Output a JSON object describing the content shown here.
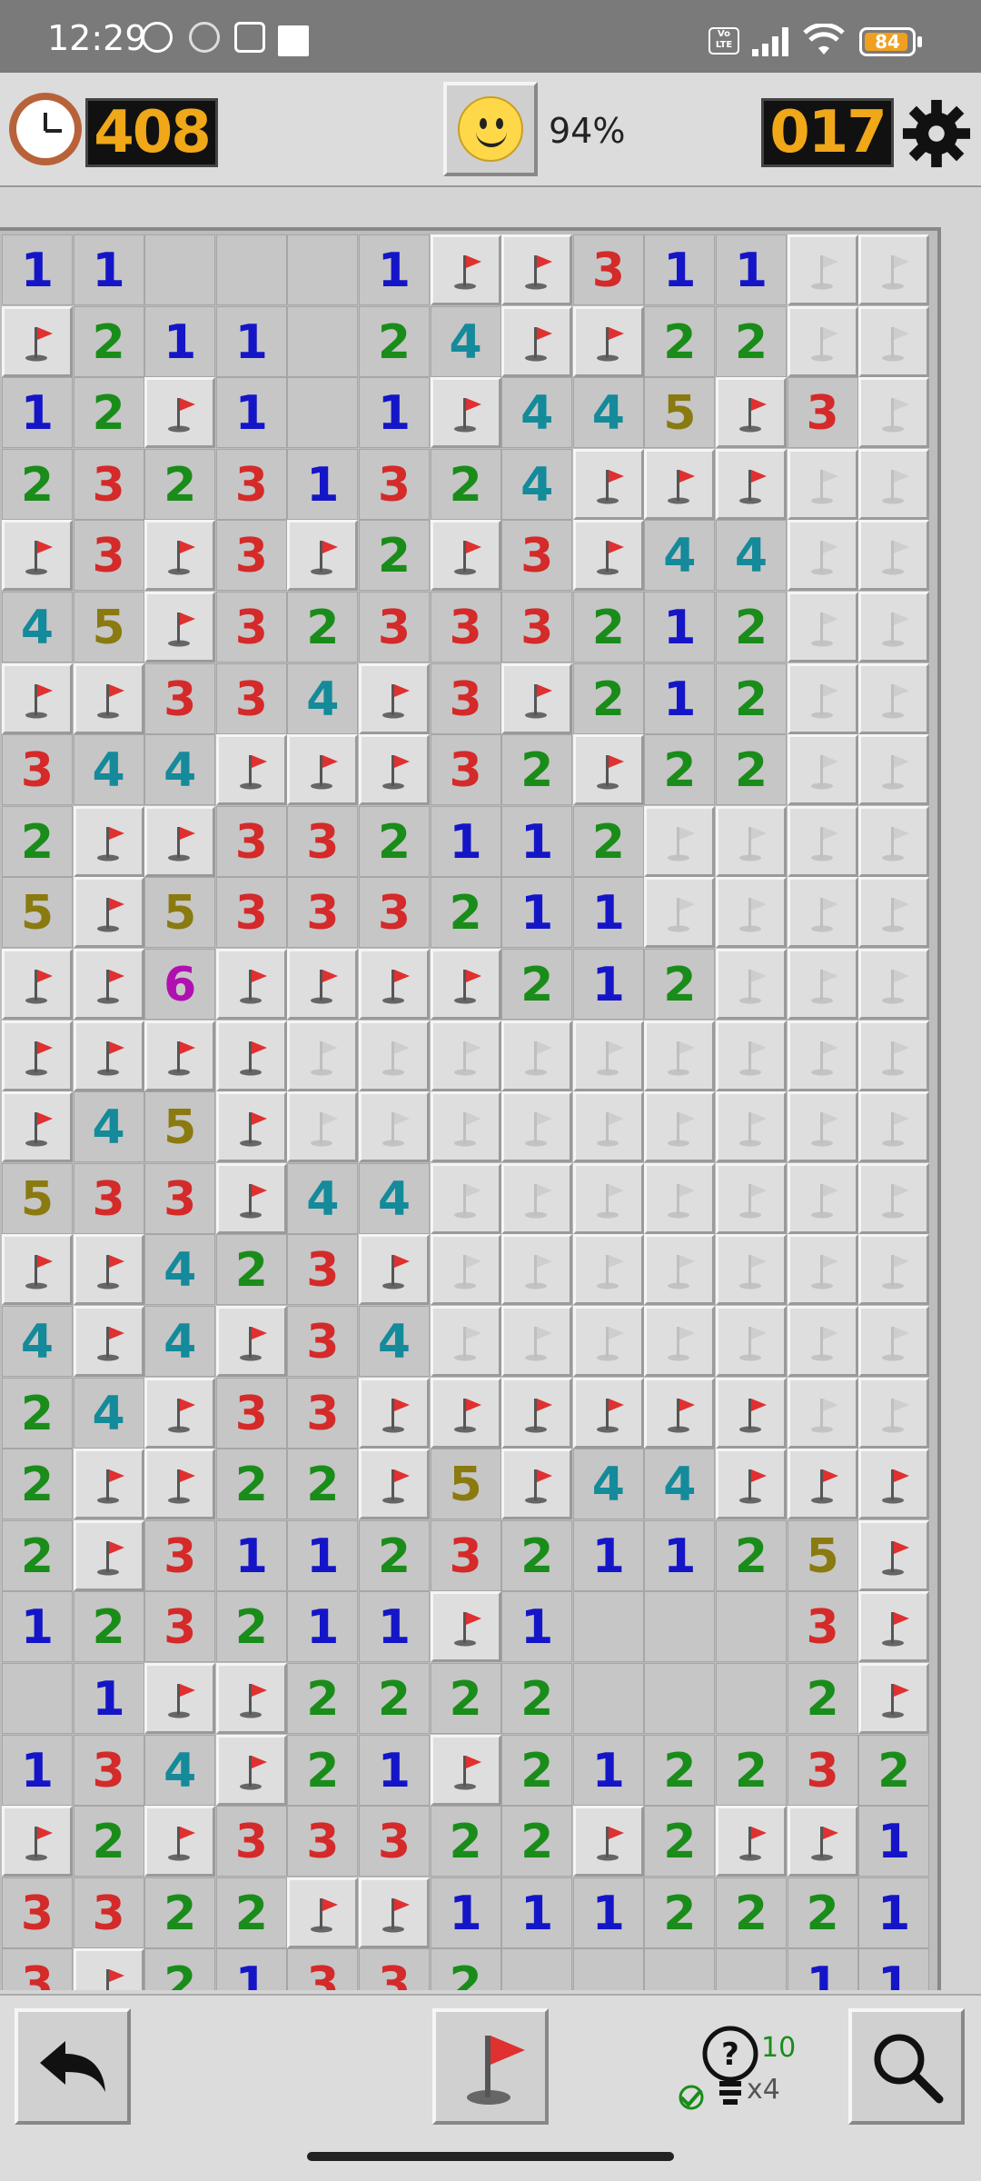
{
  "status_bar": {
    "time": "12:29",
    "battery": "84",
    "volte": "Vo LTE"
  },
  "game": {
    "timer": "408",
    "mines_remaining": "017",
    "progress": "94%",
    "hint_count": "10",
    "hint_multiplier": "x4"
  },
  "colors": {
    "n1": "#1515c8",
    "n2": "#1a8c1a",
    "n3": "#d42a2a",
    "n4": "#148a9a",
    "n5": "#8a7a10",
    "n6": "#b010b0",
    "counter_digits": "#f0a818",
    "flag": "#e03030"
  },
  "board": {
    "rows": [
      [
        "1",
        "1",
        "e",
        "e",
        "e",
        "1",
        "F",
        "F",
        "3",
        "1",
        "1",
        "f",
        "f"
      ],
      [
        "F",
        "2",
        "1",
        "1",
        "e",
        "2",
        "4",
        "F",
        "F",
        "2",
        "2",
        "f",
        "f"
      ],
      [
        "1",
        "2",
        "F",
        "1",
        "e",
        "1",
        "F",
        "4",
        "4",
        "5",
        "F",
        "3",
        "f"
      ],
      [
        "2",
        "3",
        "2",
        "3",
        "1",
        "3",
        "2",
        "4",
        "F",
        "F",
        "F",
        "f",
        "f"
      ],
      [
        "F",
        "3",
        "F",
        "3",
        "F",
        "2",
        "F",
        "3",
        "F",
        "4",
        "4",
        "f",
        "f"
      ],
      [
        "4",
        "5",
        "F",
        "3",
        "2",
        "3",
        "3",
        "3",
        "2",
        "1",
        "2",
        "f",
        "f"
      ],
      [
        "F",
        "F",
        "3",
        "3",
        "4",
        "F",
        "3",
        "F",
        "2",
        "1",
        "2",
        "f",
        "f"
      ],
      [
        "3",
        "4",
        "4",
        "F",
        "F",
        "F",
        "3",
        "2",
        "F",
        "2",
        "2",
        "f",
        "f"
      ],
      [
        "2",
        "F",
        "F",
        "3",
        "3",
        "2",
        "1",
        "1",
        "2",
        "f",
        "f",
        "f",
        "f"
      ],
      [
        "5",
        "F",
        "5",
        "3",
        "3",
        "3",
        "2",
        "1",
        "1",
        "f",
        "f",
        "f",
        "f"
      ],
      [
        "F",
        "F",
        "6",
        "F",
        "F",
        "F",
        "F",
        "2",
        "1",
        "2",
        "f",
        "f",
        "f"
      ],
      [
        "F",
        "F",
        "F",
        "F",
        "f",
        "f",
        "f",
        "f",
        "f",
        "f",
        "f",
        "f",
        "f"
      ],
      [
        "F",
        "4",
        "5",
        "F",
        "f",
        "f",
        "f",
        "f",
        "f",
        "f",
        "f",
        "f",
        "f"
      ],
      [
        "5",
        "3",
        "3",
        "F",
        "4",
        "4",
        "f",
        "f",
        "f",
        "f",
        "f",
        "f",
        "f"
      ],
      [
        "F",
        "F",
        "4",
        "2",
        "3",
        "F",
        "f",
        "f",
        "f",
        "f",
        "f",
        "f",
        "f"
      ],
      [
        "4",
        "F",
        "4",
        "F",
        "3",
        "4",
        "f",
        "f",
        "f",
        "f",
        "f",
        "f",
        "f"
      ],
      [
        "2",
        "4",
        "F",
        "3",
        "3",
        "F",
        "F",
        "F",
        "F",
        "F",
        "F",
        "f",
        "f"
      ],
      [
        "2",
        "F",
        "F",
        "2",
        "2",
        "F",
        "5",
        "F",
        "4",
        "4",
        "F",
        "F",
        "F"
      ],
      [
        "2",
        "F",
        "3",
        "1",
        "1",
        "2",
        "3",
        "2",
        "1",
        "1",
        "2",
        "5",
        "F"
      ],
      [
        "1",
        "2",
        "3",
        "2",
        "1",
        "1",
        "F",
        "1",
        "e",
        "e",
        "e",
        "3",
        "F"
      ],
      [
        "e",
        "1",
        "F",
        "F",
        "2",
        "2",
        "2",
        "2",
        "e",
        "e",
        "e",
        "2",
        "F"
      ],
      [
        "1",
        "3",
        "4",
        "F",
        "2",
        "1",
        "F",
        "2",
        "1",
        "2",
        "2",
        "3",
        "2"
      ],
      [
        "F",
        "2",
        "F",
        "3",
        "3",
        "3",
        "2",
        "2",
        "F",
        "2",
        "F",
        "F",
        "1"
      ],
      [
        "3",
        "3",
        "2",
        "2",
        "F",
        "F",
        "1",
        "1",
        "1",
        "2",
        "2",
        "2",
        "1"
      ],
      [
        "3",
        "F",
        "2",
        "1",
        "3",
        "3",
        "2",
        "e",
        "e",
        "e",
        "e",
        "1",
        "1"
      ]
    ]
  }
}
